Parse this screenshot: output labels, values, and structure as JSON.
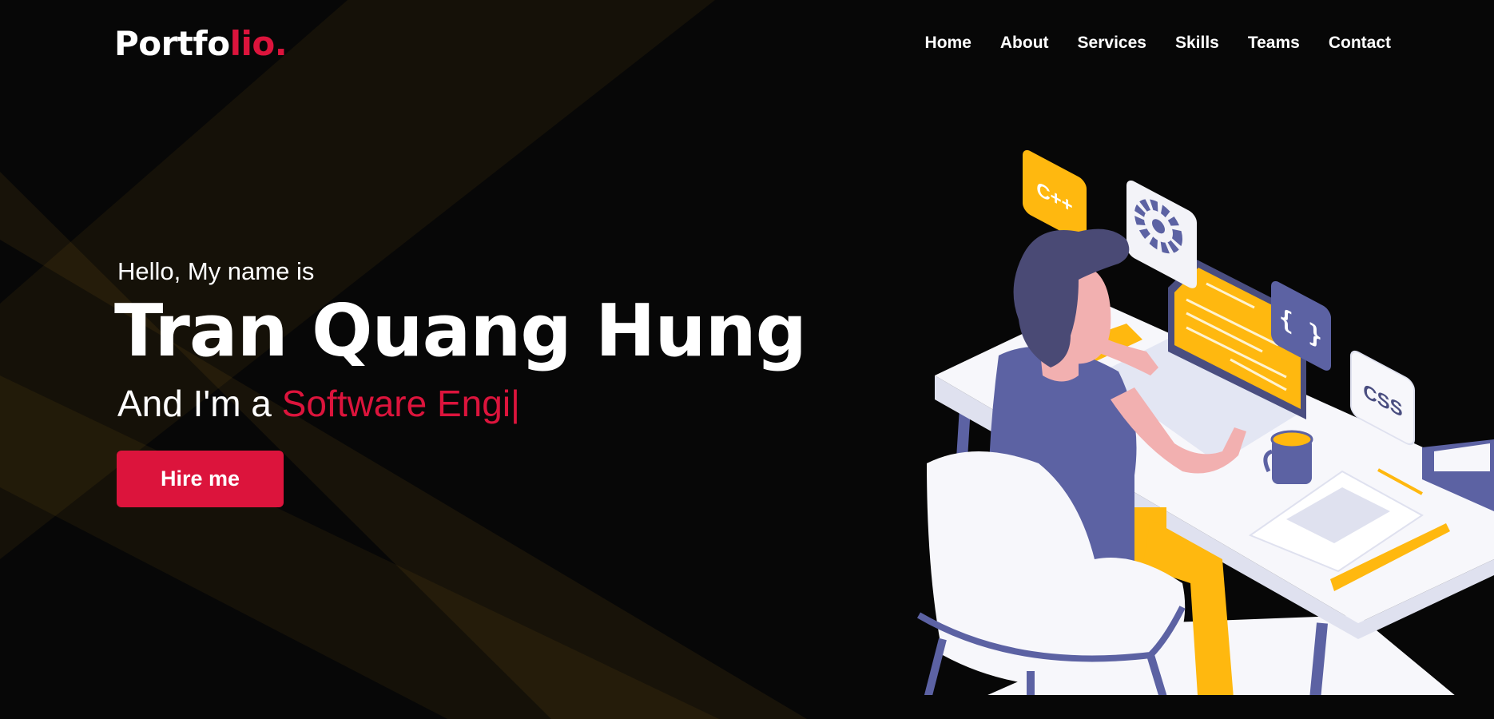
{
  "header": {
    "logo_main": "Portfo",
    "logo_accent": "lio.",
    "nav": [
      {
        "label": "Home"
      },
      {
        "label": "About"
      },
      {
        "label": "Services"
      },
      {
        "label": "Skills"
      },
      {
        "label": "Teams"
      },
      {
        "label": "Contact"
      }
    ]
  },
  "hero": {
    "greeting": "Hello, My name is",
    "name": "Tran Quang Hung",
    "role_prefix": "And I'm a ",
    "role_typed": "Software Engi",
    "cursor": "|",
    "cta_label": "Hire me"
  },
  "illustration": {
    "card_cpp": "C++",
    "card_braces": "{ }",
    "card_css": "CSS"
  },
  "colors": {
    "accent": "#dc143c",
    "background": "#070707",
    "illustration_navy": "#5c62a3",
    "illustration_yellow": "#ffb80f"
  }
}
